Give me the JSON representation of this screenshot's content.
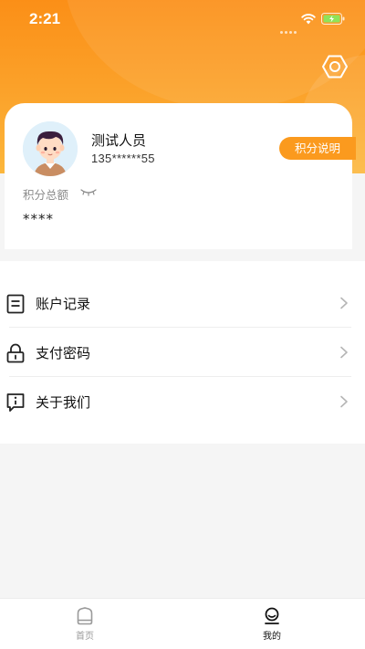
{
  "status_bar": {
    "time": "2:21"
  },
  "profile": {
    "name": "测试人员",
    "phone": "135******55",
    "points_explain_label": "积分说明",
    "points_total_label": "积分总额",
    "points_value": "****"
  },
  "menu": {
    "items": [
      {
        "label": "账户记录",
        "icon": "document-icon"
      },
      {
        "label": "支付密码",
        "icon": "lock-icon"
      },
      {
        "label": "关于我们",
        "icon": "info-icon"
      }
    ]
  },
  "tabbar": {
    "tabs": [
      {
        "label": "首页",
        "icon": "home-icon",
        "active": false
      },
      {
        "label": "我的",
        "icon": "user-icon",
        "active": true
      }
    ]
  },
  "colors": {
    "accent": "#fb9a1e",
    "header_top": "#fb8f17",
    "header_bottom": "#fcb73c"
  }
}
